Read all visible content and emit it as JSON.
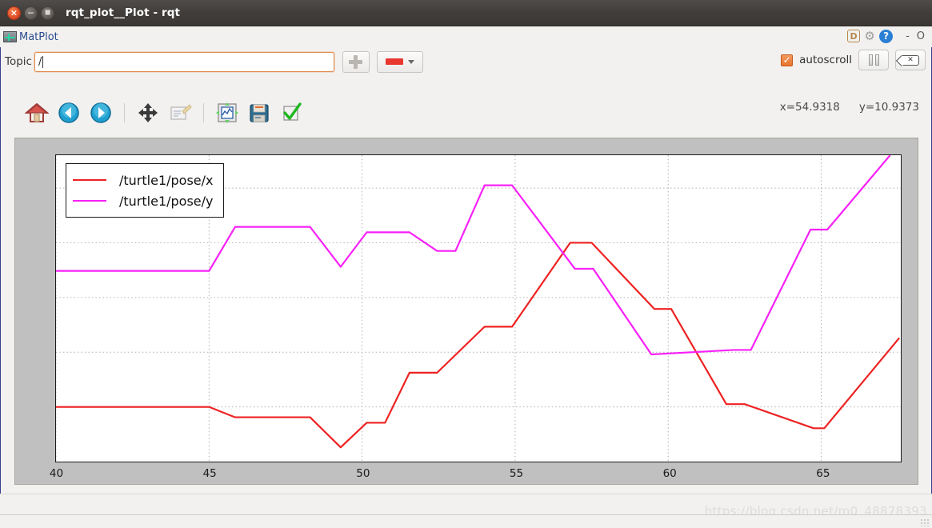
{
  "window": {
    "title": "rqt_plot__Plot - rqt",
    "close_glyph": "×",
    "minimize_glyph": "−",
    "maximize_glyph": "■"
  },
  "plugin": {
    "name": "MatPlot",
    "icon": "plot-waveform-icon",
    "dock_label": "D",
    "gear_glyph": "⚙",
    "help_glyph": "?",
    "minimize_label": "-",
    "close_label": "O"
  },
  "topic": {
    "label": "Topic",
    "value": "/",
    "placeholder": "",
    "add_button_label": "+",
    "color_value": "#e8372f"
  },
  "controls": {
    "autoscroll_label": "autoscroll",
    "autoscroll_checked": true,
    "check_glyph": "✓",
    "pause_name": "pause-button",
    "clear_glyph": "✕"
  },
  "toolbar": {
    "buttons": [
      {
        "name": "home-button",
        "label": "Home"
      },
      {
        "name": "back-button",
        "label": "Back"
      },
      {
        "name": "forward-button",
        "label": "Forward"
      },
      {
        "name": "pan-button",
        "label": "Pan"
      },
      {
        "name": "zoom-rect-button",
        "label": "Zoom to rectangle"
      },
      {
        "name": "configure-subplots-button",
        "label": "Configure subplots"
      },
      {
        "name": "save-figure-button",
        "label": "Save figure"
      },
      {
        "name": "apply-button",
        "label": "Apply"
      }
    ]
  },
  "readout": {
    "x": "x=54.9318",
    "y": "y=10.9373"
  },
  "watermark": "https://blog.csdn.net/m0_48878393",
  "chart_data": {
    "type": "line",
    "title": "",
    "xlabel": "",
    "ylabel": "",
    "xlim": [
      40,
      67.6
    ],
    "ylim": [
      0,
      11.2
    ],
    "xticks": [
      40,
      45,
      50,
      55,
      60,
      65
    ],
    "yticks": [
      0,
      2,
      4,
      6,
      8,
      10
    ],
    "grid": true,
    "legend_position": "upper-left",
    "series": [
      {
        "name": "/turtle1/pose/x",
        "color": "#ee2222",
        "points": [
          [
            40.0,
            2.0
          ],
          [
            45.0,
            2.0
          ],
          [
            45.85,
            1.62
          ],
          [
            48.3,
            1.62
          ],
          [
            49.3,
            0.52
          ],
          [
            50.15,
            1.42
          ],
          [
            50.75,
            1.42
          ],
          [
            51.55,
            3.25
          ],
          [
            52.45,
            3.25
          ],
          [
            54.0,
            4.93
          ],
          [
            54.9,
            4.93
          ],
          [
            56.8,
            8.0
          ],
          [
            57.5,
            8.0
          ],
          [
            59.55,
            5.58
          ],
          [
            60.1,
            5.58
          ],
          [
            61.9,
            2.1
          ],
          [
            62.5,
            2.1
          ],
          [
            64.75,
            1.22
          ],
          [
            65.1,
            1.22
          ],
          [
            67.55,
            4.52
          ]
        ]
      },
      {
        "name": "/turtle1/pose/y",
        "color": "#f820f8",
        "points": [
          [
            40.0,
            6.97
          ],
          [
            45.0,
            6.97
          ],
          [
            45.85,
            8.58
          ],
          [
            48.3,
            8.58
          ],
          [
            49.3,
            7.12
          ],
          [
            50.15,
            8.38
          ],
          [
            51.55,
            8.38
          ],
          [
            52.45,
            7.7
          ],
          [
            53.05,
            7.7
          ],
          [
            54.0,
            10.1
          ],
          [
            54.9,
            10.1
          ],
          [
            56.95,
            7.05
          ],
          [
            57.55,
            7.05
          ],
          [
            59.45,
            3.92
          ],
          [
            62.15,
            4.08
          ],
          [
            62.7,
            4.08
          ],
          [
            64.65,
            8.48
          ],
          [
            65.2,
            8.48
          ],
          [
            67.25,
            11.2
          ]
        ]
      }
    ]
  }
}
